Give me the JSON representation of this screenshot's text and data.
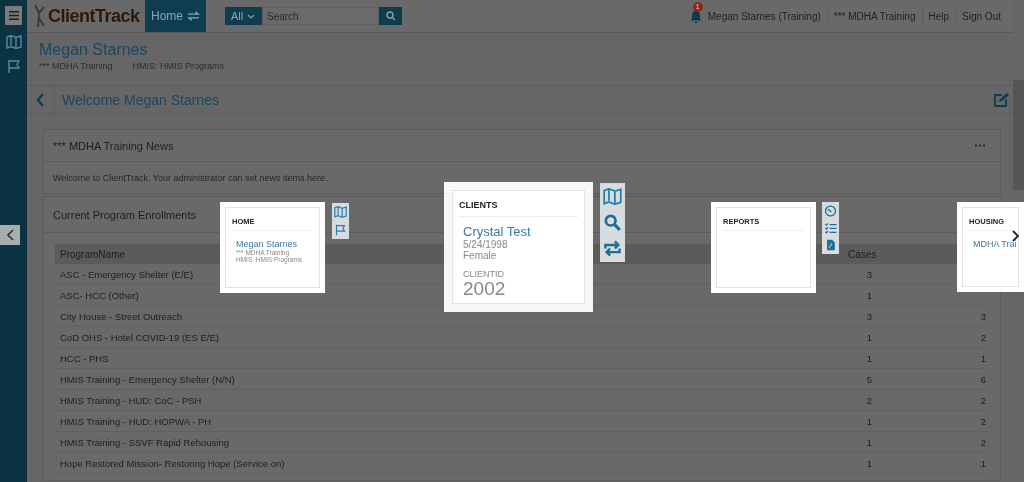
{
  "top_bar": {
    "brand": "ClientTrack",
    "home_tab": {
      "label": "Home",
      "selected": true
    },
    "search": {
      "scope": "All",
      "placeholder": "Search"
    },
    "notifications": "1",
    "user": "Megan Starnes (Training)",
    "org": "*** MDHA Training",
    "links": [
      "Help",
      "Sign Out"
    ]
  },
  "header": {
    "name": "Megan Starnes",
    "details": [
      "*** MDHA Training",
      "HMIS: HMIS Programs"
    ]
  },
  "welcome": "Welcome Megan Starnes",
  "news": {
    "title": "*** MDHA Training News",
    "body": "Welcome to ClientTrack. Your administrator can set news items here."
  },
  "enrollments": {
    "title": "Current Program Enrollments",
    "columns": [
      "ProgramName",
      "Cases"
    ],
    "rows": [
      {
        "program_name": "ASC - Emergency Shelter (E/E)",
        "cases": "3"
      },
      {
        "program_name": "ASC- HCC (Other)",
        "cases": "1"
      },
      {
        "program_name": "City House - Street Outreach",
        "cases": "3",
        "column_3": "3"
      },
      {
        "program_name": "CoD OHS - Hotel COVID-19 (ES E/E)",
        "cases": "1",
        "column_3": "2"
      },
      {
        "program_name": "HCC - PHS",
        "cases": "1",
        "column_3": "1"
      },
      {
        "program_name": "HMIS Training - Emergency Shelter (N/N)",
        "cases": "5",
        "column_3": "6"
      },
      {
        "program_name": "HMIS Training - HUD: CoC - PSH",
        "cases": "2",
        "column_3": "2"
      },
      {
        "program_name": "HMIS Training - HUD: HOPWA - PH",
        "cases": "1",
        "column_3": "2"
      },
      {
        "program_name": "HMIS Training - SSVF Rapid Rehousing",
        "cases": "1",
        "column_3": "2"
      },
      {
        "program_name": "Hope Restored Mission- Restoring Hope (Service on)",
        "cases": "1",
        "column_3": "1"
      }
    ]
  },
  "workspace_cards": [
    {
      "kind": "home",
      "title": "HOME",
      "name": "Megan Starnes",
      "lines": [
        "*** MDHA Training",
        "HMIS: HMIS Programs"
      ]
    },
    {
      "kind": "clients",
      "title": "CLIENTS",
      "name": "Crystal Test",
      "lines": [
        "5/24/1998",
        "Female"
      ],
      "id_label": "CLIENTID",
      "id": "2002"
    },
    {
      "kind": "reports",
      "title": "REPORTS"
    },
    {
      "kind": "housing",
      "title": "HOUSING",
      "name": "MDHA Trai"
    }
  ]
}
